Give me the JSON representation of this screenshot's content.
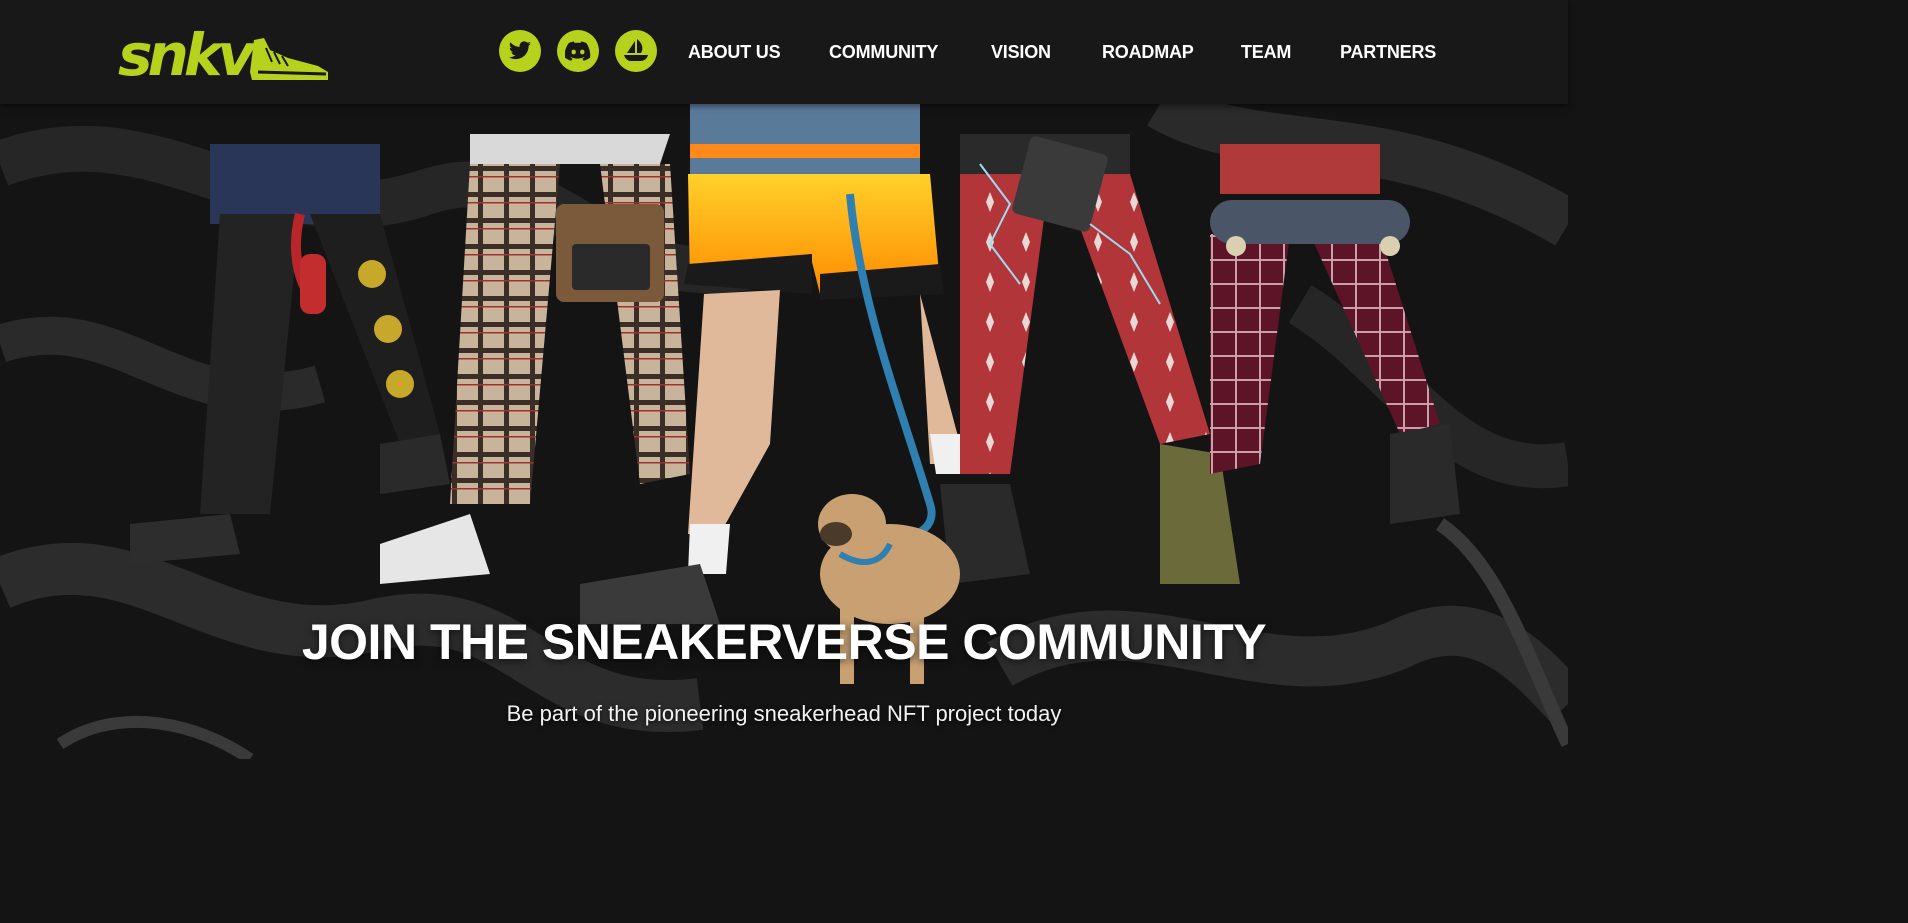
{
  "brand": {
    "logo_text": "snkv",
    "accent_color": "#b6d21c"
  },
  "socials": [
    {
      "name": "twitter-icon"
    },
    {
      "name": "discord-icon"
    },
    {
      "name": "opensea-icon"
    }
  ],
  "nav": {
    "items": [
      {
        "label": "ABOUT US"
      },
      {
        "label": "COMMUNITY"
      },
      {
        "label": "VISION"
      },
      {
        "label": "ROADMAP"
      },
      {
        "label": "TEAM"
      },
      {
        "label": "PARTNERS"
      }
    ]
  },
  "hero": {
    "title": "JOIN THE SNEAKERVERSE COMMUNITY",
    "subtitle": "Be part of the pioneering sneakerhead NFT project today"
  }
}
